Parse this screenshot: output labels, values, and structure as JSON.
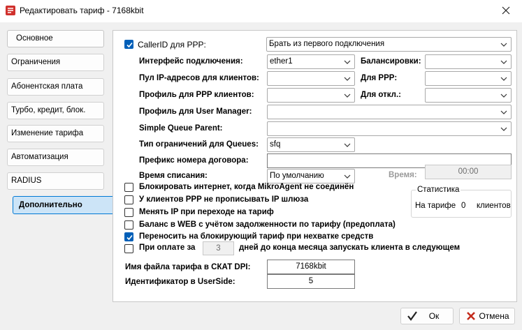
{
  "window": {
    "title": "Редактировать тариф - 7168kbit"
  },
  "nav": {
    "items": [
      "Основное",
      "Ограничения",
      "Абонентская плата",
      "Турбо, кредит, блок.",
      "Изменение тарифа",
      "Автоматизация",
      "RADIUS",
      "Дополнительно"
    ],
    "active": "Дополнительно"
  },
  "form": {
    "callerid": {
      "label": "CallerID для PPP:",
      "checked": true,
      "value": "Брать из первого подключения"
    },
    "interface": {
      "label": "Интерфейс подключения:",
      "value": "ether1"
    },
    "balancers": {
      "label": "Балансировки:",
      "value": ""
    },
    "ip_pool": {
      "label": "Пул IP-адресов для клиентов:",
      "value": ""
    },
    "for_ppp": {
      "label": "Для PPP:",
      "value": ""
    },
    "ppp_profile": {
      "label": "Профиль для PPP клиентов:",
      "value": ""
    },
    "for_disabled": {
      "label": "Для откл.:",
      "value": ""
    },
    "um_profile": {
      "label": "Профиль для User Manager:",
      "value": ""
    },
    "queue_parent": {
      "label": "Simple Queue Parent:",
      "value": ""
    },
    "queue_type": {
      "label": "Тип ограничений для Queues:",
      "value": "sfq"
    },
    "contract_prefix": {
      "label": "Префикс номера договора:",
      "value": ""
    },
    "charge_time": {
      "label": "Время списания:",
      "value": "По умолчанию"
    },
    "time": {
      "label": "Время:",
      "value": "00:00"
    }
  },
  "options": [
    {
      "label": "Блокировать интернет, когда MikroAgent не соединён",
      "checked": false
    },
    {
      "label": "У клиентов PPP не прописывать IP шлюза",
      "checked": false
    },
    {
      "label": "Менять IP при переходе на тариф",
      "checked": false
    },
    {
      "label": "Баланс в WEB с учётом задолженности по тарифу (предоплата)",
      "checked": false
    },
    {
      "label": "Переносить на блокирующий тариф при нехватке средств",
      "checked": true
    }
  ],
  "payment_option": {
    "checked": false,
    "prefix": "При оплате за",
    "days": "3",
    "suffix": "дней до конца месяца запускать клиента в следующем"
  },
  "stats": {
    "title": "Статистика",
    "prefix": "На тарифе",
    "count": "0",
    "suffix": "клиентов"
  },
  "skat": {
    "label": "Имя файла тарифа в СКАТ DPI:",
    "value": "7168kbit"
  },
  "userside": {
    "label": "Идентификатор в UserSide:",
    "value": "5"
  },
  "buttons": {
    "ok": "Ок",
    "cancel": "Отмена"
  }
}
